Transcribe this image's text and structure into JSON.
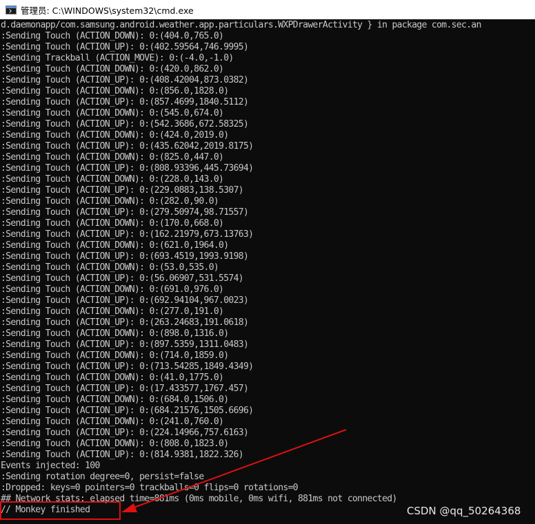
{
  "window": {
    "title": "管理员: C:\\WINDOWS\\system32\\cmd.exe",
    "icon": "cmd-icon"
  },
  "console": {
    "lines": [
      "d.daemonapp/com.samsung.android.weather.app.particulars.WXPDrawerActivity } in package com.sec.an",
      ":Sending Touch (ACTION_DOWN): 0:(404.0,765.0)",
      ":Sending Touch (ACTION_UP): 0:(402.59564,746.9995)",
      ":Sending Trackball (ACTION_MOVE): 0:(-4.0,-1.0)",
      ":Sending Touch (ACTION_DOWN): 0:(420.0,862.0)",
      ":Sending Touch (ACTION_UP): 0:(408.42004,873.0382)",
      ":Sending Touch (ACTION_DOWN): 0:(856.0,1828.0)",
      ":Sending Touch (ACTION_UP): 0:(857.4699,1840.5112)",
      ":Sending Touch (ACTION_DOWN): 0:(545.0,674.0)",
      ":Sending Touch (ACTION_UP): 0:(542.3686,672.58325)",
      ":Sending Touch (ACTION_DOWN): 0:(424.0,2019.0)",
      ":Sending Touch (ACTION_UP): 0:(435.62042,2019.8175)",
      ":Sending Touch (ACTION_DOWN): 0:(825.0,447.0)",
      ":Sending Touch (ACTION_UP): 0:(808.93396,445.73694)",
      ":Sending Touch (ACTION_DOWN): 0:(228.0,143.0)",
      ":Sending Touch (ACTION_UP): 0:(229.0883,138.5307)",
      ":Sending Touch (ACTION_DOWN): 0:(282.0,90.0)",
      ":Sending Touch (ACTION_UP): 0:(279.50974,98.71557)",
      ":Sending Touch (ACTION_DOWN): 0:(170.0,668.0)",
      ":Sending Touch (ACTION_UP): 0:(162.21979,673.13763)",
      ":Sending Touch (ACTION_DOWN): 0:(621.0,1964.0)",
      ":Sending Touch (ACTION_UP): 0:(693.4519,1993.9198)",
      ":Sending Touch (ACTION_DOWN): 0:(53.0,535.0)",
      ":Sending Touch (ACTION_UP): 0:(56.06907,531.5574)",
      ":Sending Touch (ACTION_DOWN): 0:(691.0,976.0)",
      ":Sending Touch (ACTION_UP): 0:(692.94104,967.0023)",
      ":Sending Touch (ACTION_DOWN): 0:(277.0,191.0)",
      ":Sending Touch (ACTION_UP): 0:(263.24683,191.0618)",
      ":Sending Touch (ACTION_DOWN): 0:(898.0,1316.0)",
      ":Sending Touch (ACTION_UP): 0:(897.5359,1311.0483)",
      ":Sending Touch (ACTION_DOWN): 0:(714.0,1859.0)",
      ":Sending Touch (ACTION_UP): 0:(713.54285,1849.4349)",
      ":Sending Touch (ACTION_DOWN): 0:(41.0,1775.0)",
      ":Sending Touch (ACTION_UP): 0:(17.433577,1767.457)",
      ":Sending Touch (ACTION_DOWN): 0:(684.0,1506.0)",
      ":Sending Touch (ACTION_UP): 0:(684.21576,1505.6696)",
      ":Sending Touch (ACTION_DOWN): 0:(241.0,760.0)",
      ":Sending Touch (ACTION_UP): 0:(224.14966,757.6163)",
      ":Sending Touch (ACTION_DOWN): 0:(808.0,1823.0)",
      ":Sending Touch (ACTION_UP): 0:(814.9381,1822.326)",
      "Events injected: 100",
      ":Sending rotation degree=0, persist=false",
      ":Dropped: keys=0 pointers=0 trackballs=0 flips=0 rotations=0",
      "## Network stats: elapsed time=881ms (0ms mobile, 0ms wifi, 881ms not connected)",
      "// Monkey finished"
    ]
  },
  "watermark": "CSDN @qq_50264368",
  "colors": {
    "terminal_bg": "#0c0c0c",
    "terminal_fg": "#c8c8c8",
    "annotation": "#e01010"
  }
}
